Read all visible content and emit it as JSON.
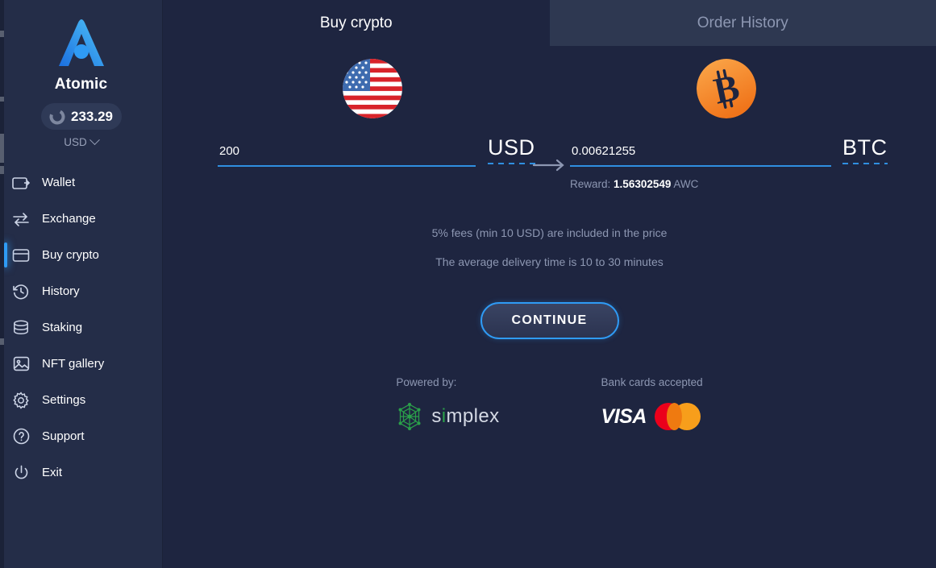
{
  "sidebar": {
    "brand_name": "Atomic",
    "logo_icon": "atomic-logo-icon",
    "balance": {
      "icon": "donut-chart-icon",
      "value": "233.29",
      "currency": "USD",
      "chevron_icon": "chevron-down-icon"
    },
    "items": [
      {
        "label": "Wallet",
        "icon": "wallet-icon",
        "active": false
      },
      {
        "label": "Exchange",
        "icon": "exchange-icon",
        "active": false
      },
      {
        "label": "Buy crypto",
        "icon": "credit-card-icon",
        "active": true
      },
      {
        "label": "History",
        "icon": "clock-history-icon",
        "active": false
      },
      {
        "label": "Staking",
        "icon": "database-icon",
        "active": false
      },
      {
        "label": "NFT gallery",
        "icon": "image-icon",
        "active": false
      },
      {
        "label": "Settings",
        "icon": "gear-icon",
        "active": false
      },
      {
        "label": "Support",
        "icon": "question-circle-icon",
        "active": false
      },
      {
        "label": "Exit",
        "icon": "power-icon",
        "active": false
      }
    ]
  },
  "tabs": {
    "buy_crypto": "Buy crypto",
    "order_history": "Order History"
  },
  "exchange": {
    "from": {
      "icon": "usa-flag-icon",
      "amount": "200",
      "placeholder": "0",
      "ticker": "USD"
    },
    "arrow_icon": "arrow-right-icon",
    "to": {
      "icon": "bitcoin-icon",
      "amount": "0.00621255",
      "placeholder": "0",
      "ticker": "BTC"
    },
    "reward": {
      "label": "Reward:",
      "value": "1.56302549",
      "unit": "AWC"
    }
  },
  "notes": {
    "fees": "5% fees (min 10 USD) are included in the price",
    "delivery": "The average delivery time is 10 to 30 minutes"
  },
  "cta": {
    "label": "CONTINUE"
  },
  "footer": {
    "powered_by_label": "Powered by:",
    "provider_name": "simplex",
    "cards_label": "Bank cards accepted",
    "visa_label": "VISA",
    "mastercard_icon": "mastercard-icon"
  },
  "colors": {
    "accent": "#2f9bf5",
    "underline": "#2f8fe0",
    "sidebar_bg": "#242d48",
    "main_bg": "#1e2540",
    "tab_inactive_bg": "#2e3851",
    "muted_text": "#8d97b2",
    "bitcoin_orange": "#f7931a",
    "simplex_green": "#2aa04a",
    "mastercard_red": "#eb001b",
    "mastercard_orange": "#f79e1b"
  }
}
